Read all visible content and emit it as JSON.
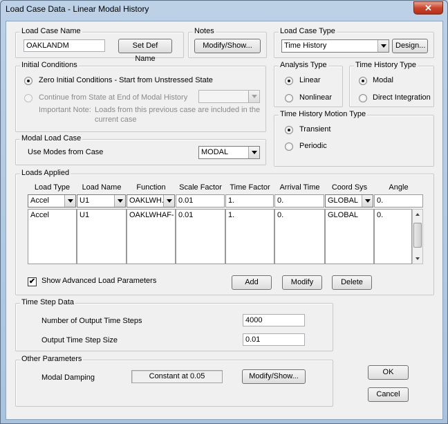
{
  "window": {
    "title": "Load Case Data - Linear Modal History",
    "close_label": "✕"
  },
  "load_case_name": {
    "legend": "Load Case Name",
    "value": "OAKLANDM",
    "set_def_name_label": "Set Def Name"
  },
  "notes": {
    "legend": "Notes",
    "button_label": "Modify/Show..."
  },
  "load_case_type": {
    "legend": "Load Case Type",
    "selected": "Time History",
    "design_label": "Design..."
  },
  "initial_conditions": {
    "legend": "Initial Conditions",
    "zero_label": "Zero Initial Conditions - Start from Unstressed State",
    "continue_label": "Continue from State at End of Modal History",
    "note_label": "Important Note:",
    "note_text_1": "Loads from this previous case are included in the",
    "note_text_2": "current case",
    "selected": "zero"
  },
  "analysis_type": {
    "legend": "Analysis Type",
    "linear_label": "Linear",
    "nonlinear_label": "Nonlinear",
    "selected": "linear"
  },
  "time_history_type": {
    "legend": "Time History Type",
    "modal_label": "Modal",
    "direct_label": "Direct Integration",
    "selected": "modal"
  },
  "motion_type": {
    "legend": "Time History Motion Type",
    "transient_label": "Transient",
    "periodic_label": "Periodic",
    "selected": "transient"
  },
  "modal_load_case": {
    "legend": "Modal Load Case",
    "label": "Use Modes from Case",
    "selected": "MODAL"
  },
  "loads_applied": {
    "legend": "Loads Applied",
    "headers": [
      "Load Type",
      "Load Name",
      "Function",
      "Scale Factor",
      "Time Factor",
      "Arrival Time",
      "Coord Sys",
      "Angle"
    ],
    "edit_row": [
      "Accel",
      "U1",
      "OAKLWH.",
      "0.01",
      "1.",
      "0.",
      "GLOBAL",
      "0."
    ],
    "rows": [
      [
        "Accel",
        "U1",
        "OAKLWHAF-",
        "0.01",
        "1.",
        "0.",
        "GLOBAL",
        "0."
      ]
    ],
    "show_advanced_label": "Show Advanced Load Parameters",
    "show_advanced_checked": "✔",
    "add_label": "Add",
    "modify_label": "Modify",
    "delete_label": "Delete"
  },
  "time_step_data": {
    "legend": "Time Step Data",
    "num_steps_label": "Number of Output Time Steps",
    "num_steps_value": "4000",
    "step_size_label": "Output Time Step Size",
    "step_size_value": "0.01"
  },
  "other_parameters": {
    "legend": "Other Parameters",
    "damping_label": "Modal Damping",
    "damping_value": "Constant at 0.05",
    "modify_show_label": "Modify/Show..."
  },
  "buttons": {
    "ok_label": "OK",
    "cancel_label": "Cancel"
  }
}
